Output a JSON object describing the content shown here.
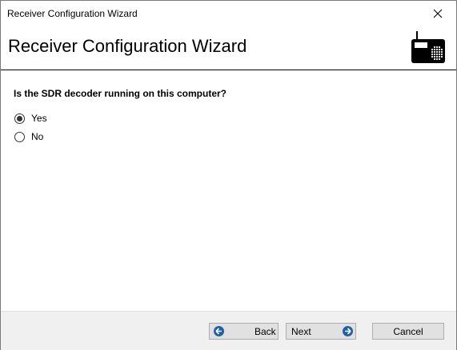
{
  "window": {
    "title": "Receiver Configuration Wizard"
  },
  "header": {
    "heading": "Receiver Configuration Wizard",
    "icon": "radio-icon"
  },
  "content": {
    "question": "Is the SDR decoder running on this computer?",
    "options": [
      {
        "label": "Yes",
        "selected": true
      },
      {
        "label": "No",
        "selected": false
      }
    ]
  },
  "footer": {
    "back_label": "Back",
    "next_label": "Next",
    "cancel_label": "Cancel"
  },
  "colors": {
    "footer_bg": "#f0f0f0",
    "button_bg": "#e1e1e1",
    "arrow_blue": "#1e5faa"
  }
}
